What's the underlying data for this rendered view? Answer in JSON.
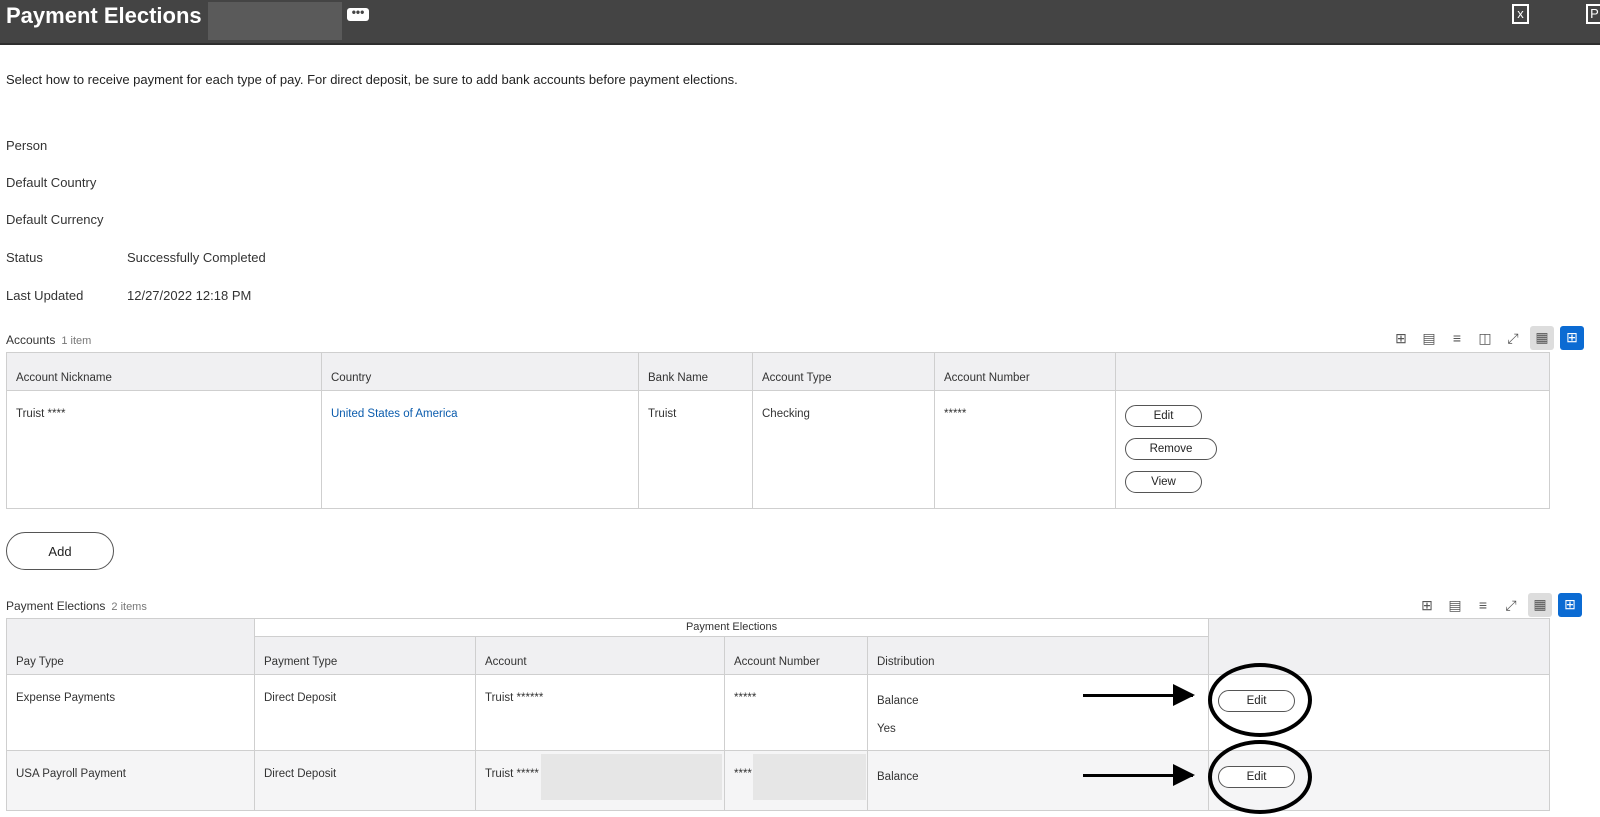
{
  "header": {
    "title": "Payment Elections",
    "more_label": "•••",
    "export_excel": "excel-export-icon",
    "export_pdf": "pdf-export-icon"
  },
  "intro": "Select how to receive payment for each type of pay. For direct deposit, be sure to add bank accounts before payment elections.",
  "fields": [
    {
      "label": "Person",
      "value": ""
    },
    {
      "label": "Default Country",
      "value": ""
    },
    {
      "label": "Default Currency",
      "value": ""
    },
    {
      "label": "Status",
      "value": "Successfully Completed"
    },
    {
      "label": "Last Updated",
      "value": "12/27/2022 12:18 PM"
    }
  ],
  "accounts": {
    "title": "Accounts",
    "count": "1 item",
    "columns": [
      "Account Nickname",
      "Country",
      "Bank Name",
      "Account Type",
      "Account Number",
      ""
    ],
    "rows": [
      {
        "nickname": "Truist ****",
        "country": "United States of America",
        "bank": "Truist",
        "type": "Checking",
        "number": "*****",
        "actions": [
          "Edit",
          "Remove",
          "View"
        ]
      }
    ],
    "add_label": "Add"
  },
  "elections": {
    "title": "Payment Elections",
    "count": "2 items",
    "group_header": "Payment Elections",
    "columns": [
      "Pay Type",
      "Payment Type",
      "Account",
      "Account Number",
      "Distribution",
      ""
    ],
    "rows": [
      {
        "pay_type": "Expense Payments",
        "payment_type": "Direct Deposit",
        "account": "Truist ******",
        "number": "*****",
        "distribution": "Balance",
        "dist2": "Yes",
        "action": "Edit"
      },
      {
        "pay_type": "USA Payroll Payment",
        "payment_type": "Direct Deposit",
        "account": "Truist *****",
        "number": "****",
        "distribution": "Balance",
        "action": "Edit"
      }
    ]
  },
  "colors": {
    "header_bg": "#444444",
    "accent": "#0b6bd3",
    "link": "#0b5cad"
  }
}
